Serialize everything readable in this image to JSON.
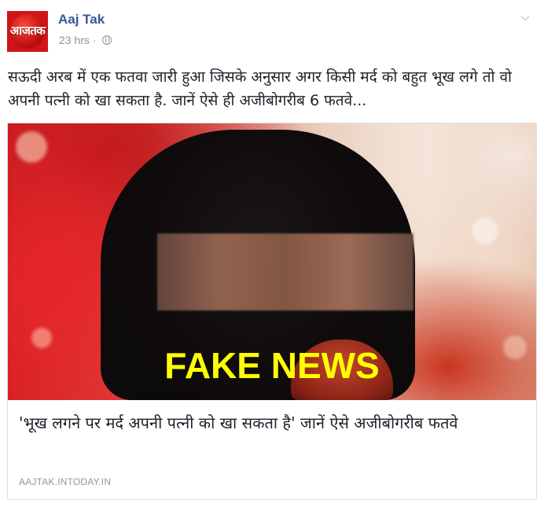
{
  "post": {
    "page_name": "Aaj Tak",
    "avatar_text": "आजतक",
    "timestamp": "23 hrs",
    "separator": "·",
    "privacy_icon": "globe-icon",
    "menu_icon": "chevron-down-icon",
    "text": "सऊदी अरब में एक फतवा जारी हुआ जिसके अनुसार अगर किसी मर्द को बहुत भूख लगे तो वो अपनी पत्नी को खा सकता है. जानें ऐसे ही अजीबोगरीब 6 फतवे..."
  },
  "link_card": {
    "overlay_label": "FAKE NEWS",
    "title": "'भूख लगने पर मर्द अपनी पत्नी को खा सकता है' जानें ऐसे अजीबोगरीब फतवे",
    "domain": "AAJTAK.INTODAY.IN"
  },
  "colors": {
    "brand_red": "#d0141a",
    "name_link": "#365899",
    "meta_gray": "#90949c",
    "overlay_yellow": "#ffff00"
  }
}
